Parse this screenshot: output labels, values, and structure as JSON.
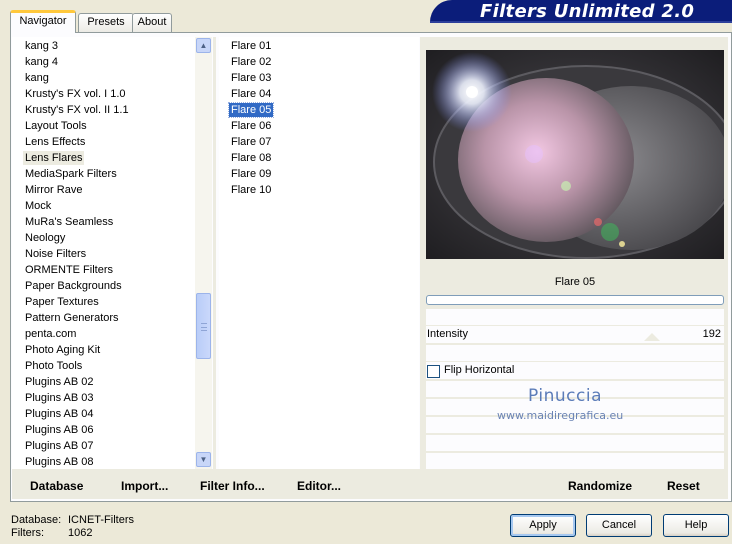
{
  "tabs": [
    "Navigator",
    "Presets",
    "About"
  ],
  "banner_title": "Filters Unlimited 2.0",
  "categories": [
    "kang 3",
    "kang 4",
    "kang",
    "Krusty's FX vol. I 1.0",
    "Krusty's FX vol. II 1.1",
    "Layout Tools",
    "Lens Effects",
    "Lens Flares",
    "MediaSpark Filters",
    "Mirror Rave",
    "Mock",
    "MuRa's Seamless",
    "Neology",
    "Noise Filters",
    "ORMENTE Filters",
    "Paper Backgrounds",
    "Paper Textures",
    "Pattern Generators",
    "penta.com",
    "Photo Aging Kit",
    "Photo Tools",
    "Plugins AB 02",
    "Plugins AB 03",
    "Plugins AB 04",
    "Plugins AB 06",
    "Plugins AB 07",
    "Plugins AB 08"
  ],
  "selected_category": "Lens Flares",
  "filters": [
    "Flare 01",
    "Flare 02",
    "Flare 03",
    "Flare 04",
    "Flare 05",
    "Flare 06",
    "Flare 07",
    "Flare 08",
    "Flare 09",
    "Flare 10"
  ],
  "selected_filter": "Flare 05",
  "bottom_links": [
    "Database",
    "Import...",
    "Filter Info...",
    "Editor..."
  ],
  "filter_name": "Flare 05",
  "progress_value": 0,
  "intensity_label": "Intensity",
  "intensity_value": "192",
  "flip_label": "Flip Horizontal",
  "flip_checked": false,
  "watermark": {
    "name": "Pinuccia",
    "site": "www.maidiregrafica.eu"
  },
  "randomize_label": "Randomize",
  "reset_label": "Reset",
  "status": {
    "db_label": "Database:",
    "db_value": "ICNET-Filters",
    "filters_label": "Filters:",
    "filters_value": "1062"
  },
  "buttons": {
    "apply": "Apply",
    "cancel": "Cancel",
    "help": "Help"
  },
  "colors": {
    "selection": "#316ac5",
    "banner": "#0b1d7a",
    "tab_accent": "#ffc83c"
  }
}
